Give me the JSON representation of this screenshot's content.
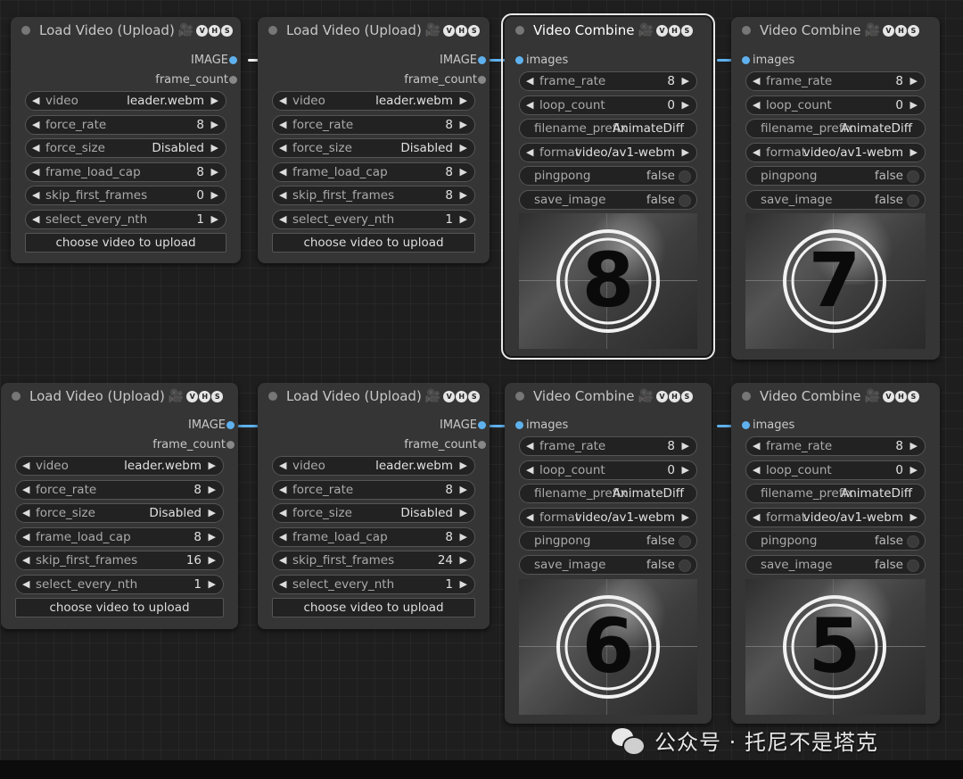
{
  "badges": [
    "V",
    "H",
    "S"
  ],
  "icons": {
    "camera": "🎥"
  },
  "load_nodes": [
    {
      "title": "Load Video (Upload)",
      "outputs": [
        "IMAGE",
        "frame_count"
      ],
      "widgets": [
        {
          "label": "video",
          "value": "leader.webm"
        },
        {
          "label": "force_rate",
          "value": "8"
        },
        {
          "label": "force_size",
          "value": "Disabled"
        },
        {
          "label": "frame_load_cap",
          "value": "8"
        },
        {
          "label": "skip_first_frames",
          "value": "0"
        },
        {
          "label": "select_every_nth",
          "value": "1"
        }
      ],
      "button": "choose video to upload"
    },
    {
      "title": "Load Video (Upload)",
      "outputs": [
        "IMAGE",
        "frame_count"
      ],
      "widgets": [
        {
          "label": "video",
          "value": "leader.webm"
        },
        {
          "label": "force_rate",
          "value": "8"
        },
        {
          "label": "force_size",
          "value": "Disabled"
        },
        {
          "label": "frame_load_cap",
          "value": "8"
        },
        {
          "label": "skip_first_frames",
          "value": "8"
        },
        {
          "label": "select_every_nth",
          "value": "1"
        }
      ],
      "button": "choose video to upload"
    },
    {
      "title": "Load Video (Upload)",
      "outputs": [
        "IMAGE",
        "frame_count"
      ],
      "widgets": [
        {
          "label": "video",
          "value": "leader.webm"
        },
        {
          "label": "force_rate",
          "value": "8"
        },
        {
          "label": "force_size",
          "value": "Disabled"
        },
        {
          "label": "frame_load_cap",
          "value": "8"
        },
        {
          "label": "skip_first_frames",
          "value": "16"
        },
        {
          "label": "select_every_nth",
          "value": "1"
        }
      ],
      "button": "choose video to upload"
    },
    {
      "title": "Load Video (Upload)",
      "outputs": [
        "IMAGE",
        "frame_count"
      ],
      "widgets": [
        {
          "label": "video",
          "value": "leader.webm"
        },
        {
          "label": "force_rate",
          "value": "8"
        },
        {
          "label": "force_size",
          "value": "Disabled"
        },
        {
          "label": "frame_load_cap",
          "value": "8"
        },
        {
          "label": "skip_first_frames",
          "value": "24"
        },
        {
          "label": "select_every_nth",
          "value": "1"
        }
      ],
      "button": "choose video to upload"
    }
  ],
  "combine_nodes": [
    {
      "title": "Video Combine",
      "input": "images",
      "widgets": [
        {
          "label": "frame_rate",
          "value": "8",
          "kind": "num"
        },
        {
          "label": "loop_count",
          "value": "0",
          "kind": "num"
        },
        {
          "label": "filename_prefix",
          "value": "AnimateDiff",
          "kind": "text"
        },
        {
          "label": "format",
          "value": "video/av1-webm",
          "kind": "combo"
        },
        {
          "label": "pingpong",
          "value": "false",
          "kind": "toggle"
        },
        {
          "label": "save_image",
          "value": "false",
          "kind": "toggle"
        }
      ],
      "preview_number": "8"
    },
    {
      "title": "Video Combine",
      "input": "images",
      "widgets": [
        {
          "label": "frame_rate",
          "value": "8",
          "kind": "num"
        },
        {
          "label": "loop_count",
          "value": "0",
          "kind": "num"
        },
        {
          "label": "filename_prefix",
          "value": "AnimateDiff",
          "kind": "text"
        },
        {
          "label": "format",
          "value": "video/av1-webm",
          "kind": "combo"
        },
        {
          "label": "pingpong",
          "value": "false",
          "kind": "toggle"
        },
        {
          "label": "save_image",
          "value": "false",
          "kind": "toggle"
        }
      ],
      "preview_number": "7"
    },
    {
      "title": "Video Combine",
      "input": "images",
      "widgets": [
        {
          "label": "frame_rate",
          "value": "8",
          "kind": "num"
        },
        {
          "label": "loop_count",
          "value": "0",
          "kind": "num"
        },
        {
          "label": "filename_prefix",
          "value": "AnimateDiff",
          "kind": "text"
        },
        {
          "label": "format",
          "value": "video/av1-webm",
          "kind": "combo"
        },
        {
          "label": "pingpong",
          "value": "false",
          "kind": "toggle"
        },
        {
          "label": "save_image",
          "value": "false",
          "kind": "toggle"
        }
      ],
      "preview_number": "6"
    },
    {
      "title": "Video Combine",
      "input": "images",
      "widgets": [
        {
          "label": "frame_rate",
          "value": "8",
          "kind": "num"
        },
        {
          "label": "loop_count",
          "value": "0",
          "kind": "num"
        },
        {
          "label": "filename_prefix",
          "value": "AnimateDiff",
          "kind": "text"
        },
        {
          "label": "format",
          "value": "video/av1-webm",
          "kind": "combo"
        },
        {
          "label": "pingpong",
          "value": "false",
          "kind": "toggle"
        },
        {
          "label": "save_image",
          "value": "false",
          "kind": "toggle"
        }
      ],
      "preview_number": "5"
    }
  ],
  "watermark": "公众号 · 托尼不是塔克",
  "colors": {
    "link": "#5fb1ee",
    "node_bg": "#353535",
    "widget_bg": "#222222"
  }
}
